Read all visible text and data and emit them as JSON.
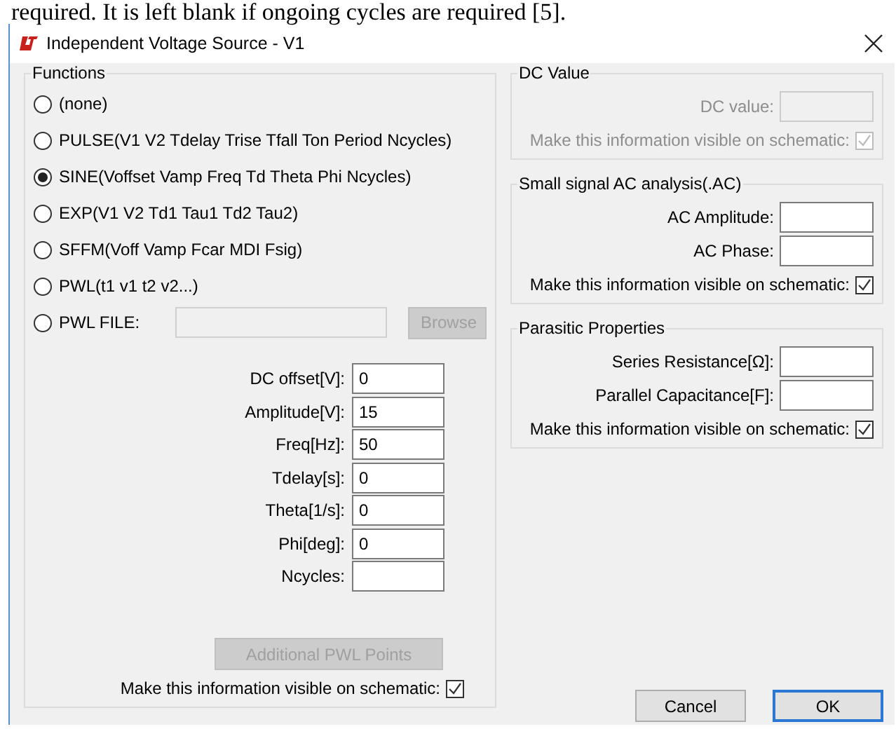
{
  "document_text": "required. It is left blank if ongoing cycles are required [5].",
  "window": {
    "title": "Independent Voltage Source - V1"
  },
  "functions": {
    "title": "Functions",
    "options": [
      {
        "kind": "plain",
        "label": "(none)",
        "selected": false
      },
      {
        "kind": "plain",
        "label": "PULSE(V1 V2 Tdelay Trise Tfall Ton Period Ncycles)",
        "selected": false
      },
      {
        "kind": "plain",
        "label": "SINE(Voffset Vamp Freq Td Theta Phi Ncycles)",
        "selected": true
      },
      {
        "kind": "plain",
        "label": "EXP(V1 V2 Td1 Tau1 Td2 Tau2)",
        "selected": false
      },
      {
        "kind": "plain",
        "label": "SFFM(Voff Vamp Fcar MDI Fsig)",
        "selected": false
      },
      {
        "kind": "plain",
        "label": "PWL(t1 v1 t2 v2...)",
        "selected": false
      },
      {
        "kind": "file",
        "label": "PWL FILE:",
        "selected": false,
        "disabled": true,
        "browse": "Browse"
      }
    ],
    "parameters": [
      {
        "label": "DC offset[V]:",
        "value": "0"
      },
      {
        "label": "Amplitude[V]:",
        "value": "15"
      },
      {
        "label": "Freq[Hz]:",
        "value": "50"
      },
      {
        "label": "Tdelay[s]:",
        "value": "0"
      },
      {
        "label": "Theta[1/s]:",
        "value": "0"
      },
      {
        "label": "Phi[deg]:",
        "value": "0"
      },
      {
        "label": "Ncycles:"
      }
    ],
    "additional_button": {
      "label": "Additional PWL Points",
      "disabled": true
    },
    "visible": {
      "label": "Make this information visible on schematic:",
      "checked": true
    }
  },
  "groups": [
    {
      "title": "DC Value",
      "disabled": true,
      "fields": [
        {
          "label": "DC value:"
        }
      ],
      "visible": {
        "label": "Make this information visible on schematic:",
        "checked": true
      }
    },
    {
      "title": "Small signal AC analysis(.AC)",
      "disabled": false,
      "fields": [
        {
          "label": "AC Amplitude:"
        },
        {
          "label": "AC Phase:"
        }
      ],
      "visible": {
        "label": "Make this information visible on schematic:",
        "checked": true
      }
    },
    {
      "title": "Parasitic Properties",
      "disabled": false,
      "fields": [
        {
          "label": "Series Resistance[Ω]:"
        },
        {
          "label": "Parallel Capacitance[F]:"
        }
      ],
      "visible": {
        "label": "Make this information visible on schematic:",
        "checked": true
      }
    }
  ],
  "buttons": [
    {
      "label": "Cancel",
      "default": false
    },
    {
      "label": "OK",
      "default": true
    }
  ]
}
